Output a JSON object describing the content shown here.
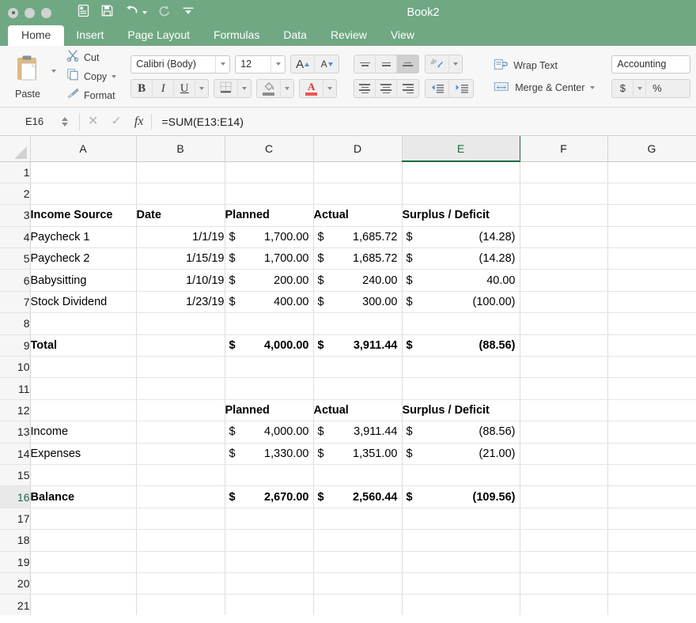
{
  "window": {
    "title": "Book2",
    "traffic_lights": [
      "close-button",
      "minimize-button",
      "zoom-button"
    ],
    "accent_green": "#6fa883",
    "active_header_green": "#1e6b43"
  },
  "quick_access": [
    {
      "name": "new-from-template-icon",
      "label": "New"
    },
    {
      "name": "save-icon",
      "label": "Save"
    },
    {
      "name": "undo-icon",
      "label": "Undo"
    },
    {
      "name": "redo-icon",
      "label": "Redo"
    },
    {
      "name": "customize-toolbar-icon",
      "label": "Customize"
    }
  ],
  "ribbon_tabs": [
    {
      "label": "Home",
      "active": true
    },
    {
      "label": "Insert",
      "active": false
    },
    {
      "label": "Page Layout",
      "active": false
    },
    {
      "label": "Formulas",
      "active": false
    },
    {
      "label": "Data",
      "active": false
    },
    {
      "label": "Review",
      "active": false
    },
    {
      "label": "View",
      "active": false
    }
  ],
  "ribbon": {
    "clipboard": {
      "paste_label": "Paste",
      "cut_label": "Cut",
      "copy_label": "Copy",
      "format_label": "Format"
    },
    "font": {
      "font_name": "Calibri (Body)",
      "font_size": "12",
      "grow_font_label": "A",
      "shrink_font_label": "A",
      "bold_label": "B",
      "italic_label": "I",
      "underline_label": "U",
      "font_color": "#f0534f"
    },
    "alignment": {
      "wrap_text_label": "Wrap Text",
      "merge_center_label": "Merge & Center",
      "vertical_selected": "bottom",
      "horizontal_selected": "none"
    },
    "number": {
      "format_value": "Accounting",
      "currency_label": "$",
      "percent_label": "%"
    }
  },
  "formula_bar": {
    "name_box": "E16",
    "cancel_label": "✕",
    "enter_label": "✓",
    "fx_label": "fx",
    "formula": "=SUM(E13:E14)"
  },
  "grid": {
    "columns": [
      "A",
      "B",
      "C",
      "D",
      "E",
      "F",
      "G"
    ],
    "active_column": "E",
    "active_row": 16,
    "selected_cell": "E16",
    "rows": [
      {
        "n": 1,
        "A": "",
        "B": "",
        "C": "",
        "D": "",
        "E_sym": "",
        "E_amt": ""
      },
      {
        "n": 2,
        "A": "",
        "B": "",
        "C": "",
        "D": "",
        "E_sym": "",
        "E_amt": ""
      },
      {
        "n": 3,
        "A": "Income Source",
        "B": "Date",
        "C": "Planned",
        "D": "Actual",
        "E_sym": "",
        "E_amt": "Surplus / Deficit",
        "bold": true,
        "header": true
      },
      {
        "n": 4,
        "A": "Paycheck 1",
        "B": "1/1/19",
        "C_sym": "$",
        "C_amt": "1,700.00",
        "D_sym": "$",
        "D_amt": "1,685.72",
        "E_sym": "$",
        "E_amt": "(14.28)"
      },
      {
        "n": 5,
        "A": "Paycheck 2",
        "B": "1/15/19",
        "C_sym": "$",
        "C_amt": "1,700.00",
        "D_sym": "$",
        "D_amt": "1,685.72",
        "E_sym": "$",
        "E_amt": "(14.28)"
      },
      {
        "n": 6,
        "A": "Babysitting",
        "B": "1/10/19",
        "C_sym": "$",
        "C_amt": "200.00",
        "D_sym": "$",
        "D_amt": "240.00",
        "E_sym": "$",
        "E_amt": "40.00"
      },
      {
        "n": 7,
        "A": "Stock Dividend",
        "B": "1/23/19",
        "C_sym": "$",
        "C_amt": "400.00",
        "D_sym": "$",
        "D_amt": "300.00",
        "E_sym": "$",
        "E_amt": "(100.00)"
      },
      {
        "n": 8,
        "A": "",
        "B": "",
        "C": "",
        "D": "",
        "E_sym": "",
        "E_amt": ""
      },
      {
        "n": 9,
        "A": "Total",
        "B": "",
        "C_sym": "$",
        "C_amt": "4,000.00",
        "D_sym": "$",
        "D_amt": "3,911.44",
        "E_sym": "$",
        "E_amt": "(88.56)",
        "bold": true
      },
      {
        "n": 10,
        "A": "",
        "B": "",
        "C": "",
        "D": "",
        "E_sym": "",
        "E_amt": ""
      },
      {
        "n": 11,
        "A": "",
        "B": "",
        "C": "",
        "D": "",
        "E_sym": "",
        "E_amt": ""
      },
      {
        "n": 12,
        "A": "",
        "B": "",
        "C": "Planned",
        "D": "Actual",
        "E_sym": "",
        "E_amt": "Surplus / Deficit",
        "bold": true,
        "header": true
      },
      {
        "n": 13,
        "A": "Income",
        "B": "",
        "C_sym": "$",
        "C_amt": "4,000.00",
        "D_sym": "$",
        "D_amt": "3,911.44",
        "E_sym": "$",
        "E_amt": "(88.56)"
      },
      {
        "n": 14,
        "A": "Expenses",
        "B": "",
        "C_sym": "$",
        "C_amt": "1,330.00",
        "D_sym": "$",
        "D_amt": "1,351.00",
        "E_sym": "$",
        "E_amt": "(21.00)"
      },
      {
        "n": 15,
        "A": "",
        "B": "",
        "C": "",
        "D": "",
        "E_sym": "",
        "E_amt": ""
      },
      {
        "n": 16,
        "A": "Balance",
        "B": "",
        "C_sym": "$",
        "C_amt": "2,670.00",
        "D_sym": "$",
        "D_amt": "2,560.44",
        "E_sym": "$",
        "E_amt": "(109.56)",
        "bold": true
      },
      {
        "n": 17,
        "A": "",
        "B": "",
        "C": "",
        "D": "",
        "E_sym": "",
        "E_amt": ""
      },
      {
        "n": 18,
        "A": "",
        "B": "",
        "C": "",
        "D": "",
        "E_sym": "",
        "E_amt": ""
      },
      {
        "n": 19,
        "A": "",
        "B": "",
        "C": "",
        "D": "",
        "E_sym": "",
        "E_amt": ""
      },
      {
        "n": 20,
        "A": "",
        "B": "",
        "C": "",
        "D": "",
        "E_sym": "",
        "E_amt": ""
      },
      {
        "n": 21,
        "A": "",
        "B": "",
        "C": "",
        "D": "",
        "E_sym": "",
        "E_amt": ""
      }
    ]
  }
}
